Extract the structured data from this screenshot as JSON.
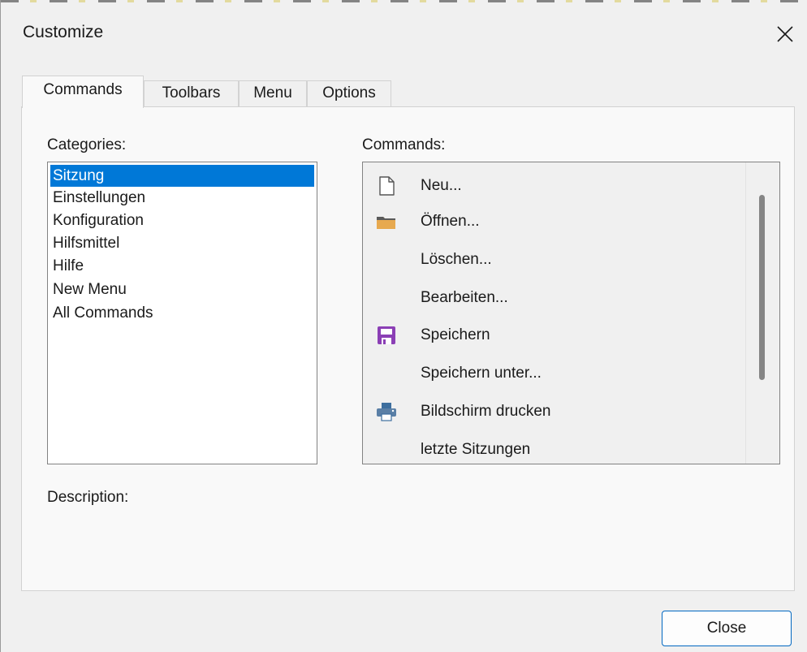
{
  "window": {
    "title": "Customize"
  },
  "tabs": [
    {
      "label": "Commands",
      "active": true
    },
    {
      "label": "Toolbars",
      "active": false
    },
    {
      "label": "Menu",
      "active": false
    },
    {
      "label": "Options",
      "active": false
    }
  ],
  "categories": {
    "label": "Categories:",
    "items": [
      {
        "label": "Sitzung",
        "selected": true
      },
      {
        "label": "Einstellungen",
        "selected": false
      },
      {
        "label": "Konfiguration",
        "selected": false
      },
      {
        "label": "Hilfsmittel",
        "selected": false
      },
      {
        "label": "Hilfe",
        "selected": false
      },
      {
        "label": "New Menu",
        "selected": false
      },
      {
        "label": "All Commands",
        "selected": false
      }
    ]
  },
  "commands": {
    "label": "Commands:",
    "items": [
      {
        "label": "Neu...",
        "icon": "new-document-icon"
      },
      {
        "label": "Öffnen...",
        "icon": "folder-icon"
      },
      {
        "label": "Löschen...",
        "icon": ""
      },
      {
        "label": "Bearbeiten...",
        "icon": ""
      },
      {
        "label": "Speichern",
        "icon": "save-icon"
      },
      {
        "label": "Speichern unter...",
        "icon": ""
      },
      {
        "label": "Bildschirm drucken",
        "icon": "printer-icon"
      },
      {
        "label": "letzte Sitzungen",
        "icon": ""
      }
    ]
  },
  "description": {
    "label": "Description:",
    "text": ""
  },
  "buttons": {
    "close_label": "Close"
  },
  "colors": {
    "selection": "#0078d7",
    "folder": "#e7a94f",
    "save": "#8b3fb5",
    "printer": "#3d6e9e"
  }
}
